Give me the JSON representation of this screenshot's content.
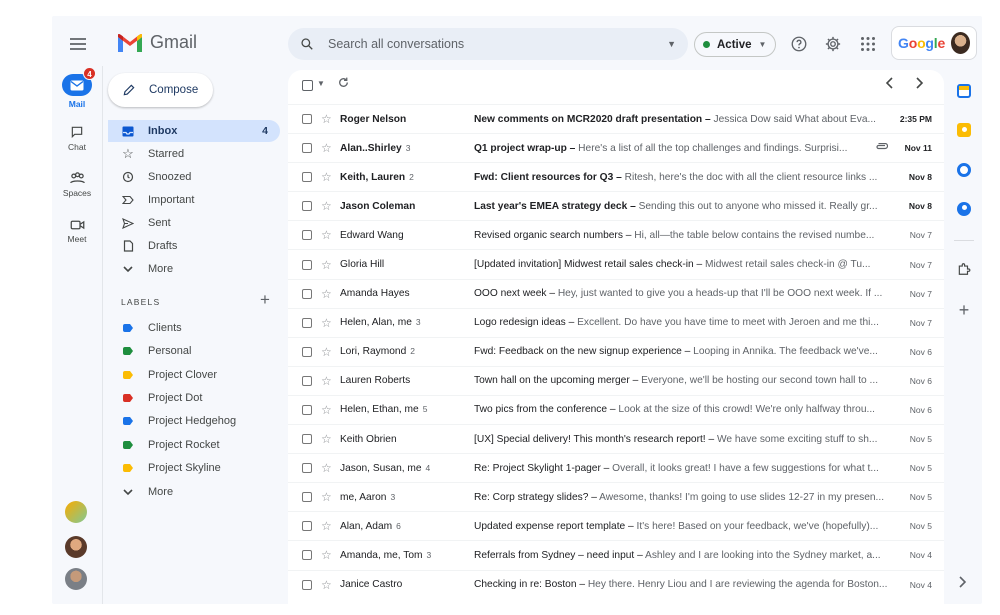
{
  "app": {
    "name": "Gmail"
  },
  "search": {
    "placeholder": "Search all conversations"
  },
  "status": {
    "label": "Active",
    "color": "#1e8e3e"
  },
  "account": {
    "brand": "Google"
  },
  "rail": {
    "mail": {
      "label": "Mail",
      "badge": "4"
    },
    "chat": {
      "label": "Chat"
    },
    "spaces": {
      "label": "Spaces"
    },
    "meet": {
      "label": "Meet"
    }
  },
  "compose": {
    "label": "Compose"
  },
  "nav": [
    {
      "label": "Inbox",
      "count": "4",
      "icon": "inbox-icon"
    },
    {
      "label": "Starred",
      "icon": "star-icon"
    },
    {
      "label": "Snoozed",
      "icon": "clock-icon"
    },
    {
      "label": "Important",
      "icon": "important-icon"
    },
    {
      "label": "Sent",
      "icon": "send-icon"
    },
    {
      "label": "Drafts",
      "icon": "draft-icon"
    },
    {
      "label": "More",
      "icon": "chevron-down-icon"
    }
  ],
  "labels": {
    "title": "LABELS",
    "items": [
      {
        "label": "Clients",
        "color": "#1a73e8"
      },
      {
        "label": "Personal",
        "color": "#1e8e3e"
      },
      {
        "label": "Project Clover",
        "color": "#fbbc04"
      },
      {
        "label": "Project Dot",
        "color": "#d93025"
      },
      {
        "label": "Project Hedgehog",
        "color": "#1a73e8"
      },
      {
        "label": "Project Rocket",
        "color": "#1e8e3e"
      },
      {
        "label": "Project Skyline",
        "color": "#fbbc04"
      }
    ],
    "more": "More"
  },
  "emails": [
    {
      "sender": "Roger Nelson",
      "n": "",
      "subject": "New comments on MCR2020 draft presentation",
      "snippet": "Jessica Dow said What about Eva...",
      "date": "2:35 PM",
      "unread": true,
      "attach": false
    },
    {
      "sender": "Alan..Shirley",
      "n": "3",
      "subject": "Q1 project wrap-up",
      "snippet": "Here's a list of all the top challenges and findings. Surprisi...",
      "date": "Nov 11",
      "unread": true,
      "attach": true
    },
    {
      "sender": "Keith, Lauren",
      "n": "2",
      "subject": "Fwd: Client resources for Q3",
      "snippet": "Ritesh, here's the doc with all the client resource links ...",
      "date": "Nov 8",
      "unread": true,
      "attach": false
    },
    {
      "sender": "Jason Coleman",
      "n": "",
      "subject": "Last year's EMEA strategy deck",
      "snippet": "Sending this out to anyone who missed it. Really gr...",
      "date": "Nov 8",
      "unread": true,
      "attach": false
    },
    {
      "sender": "Edward Wang",
      "n": "",
      "subject": "Revised organic search numbers",
      "snippet": "Hi, all—the table below contains the revised numbe...",
      "date": "Nov 7",
      "unread": false,
      "attach": false
    },
    {
      "sender": "Gloria Hill",
      "n": "",
      "subject": "[Updated invitation] Midwest retail sales check-in",
      "snippet": "Midwest retail sales check-in @ Tu...",
      "date": "Nov 7",
      "unread": false,
      "attach": false
    },
    {
      "sender": "Amanda Hayes",
      "n": "",
      "subject": "OOO next week",
      "snippet": "Hey, just wanted to give you a heads-up that I'll be OOO next week. If ...",
      "date": "Nov 7",
      "unread": false,
      "attach": false
    },
    {
      "sender": "Helen, Alan, me",
      "n": "3",
      "subject": "Logo redesign ideas",
      "snippet": "Excellent. Do have you have time to meet with Jeroen and me thi...",
      "date": "Nov 7",
      "unread": false,
      "attach": false
    },
    {
      "sender": "Lori, Raymond",
      "n": "2",
      "subject": "Fwd: Feedback on the new signup experience",
      "snippet": "Looping in Annika. The feedback we've...",
      "date": "Nov 6",
      "unread": false,
      "attach": false
    },
    {
      "sender": "Lauren Roberts",
      "n": "",
      "subject": "Town hall on the upcoming merger",
      "snippet": "Everyone, we'll be hosting our second town hall to ...",
      "date": "Nov 6",
      "unread": false,
      "attach": false
    },
    {
      "sender": "Helen, Ethan, me",
      "n": "5",
      "subject": "Two pics from the conference",
      "snippet": "Look at the size of this crowd! We're only halfway throu...",
      "date": "Nov 6",
      "unread": false,
      "attach": false
    },
    {
      "sender": "Keith Obrien",
      "n": "",
      "subject": "[UX] Special delivery! This month's research report!",
      "snippet": "We have some exciting stuff to sh...",
      "date": "Nov 5",
      "unread": false,
      "attach": false
    },
    {
      "sender": "Jason, Susan, me",
      "n": "4",
      "subject": "Re: Project Skylight 1-pager",
      "snippet": "Overall, it looks great! I have a few suggestions for what t...",
      "date": "Nov 5",
      "unread": false,
      "attach": false
    },
    {
      "sender": "me, Aaron",
      "n": "3",
      "subject": "Re: Corp strategy slides?",
      "snippet": "Awesome, thanks! I'm going to use slides 12-27 in my presen...",
      "date": "Nov 5",
      "unread": false,
      "attach": false
    },
    {
      "sender": "Alan, Adam",
      "n": "6",
      "subject": "Updated expense report template",
      "snippet": "It's here! Based on your feedback, we've (hopefully)...",
      "date": "Nov 5",
      "unread": false,
      "attach": false
    },
    {
      "sender": "Amanda, me, Tom",
      "n": "3",
      "subject": "Referrals from Sydney – need input",
      "snippet": "Ashley and I are looking into the Sydney market, a...",
      "date": "Nov 4",
      "unread": false,
      "attach": false
    },
    {
      "sender": "Janice Castro",
      "n": "",
      "subject": "Checking in re: Boston",
      "snippet": "Hey there. Henry Liou and I are reviewing the agenda for Boston...",
      "date": "Nov 4",
      "unread": false,
      "attach": false
    }
  ]
}
